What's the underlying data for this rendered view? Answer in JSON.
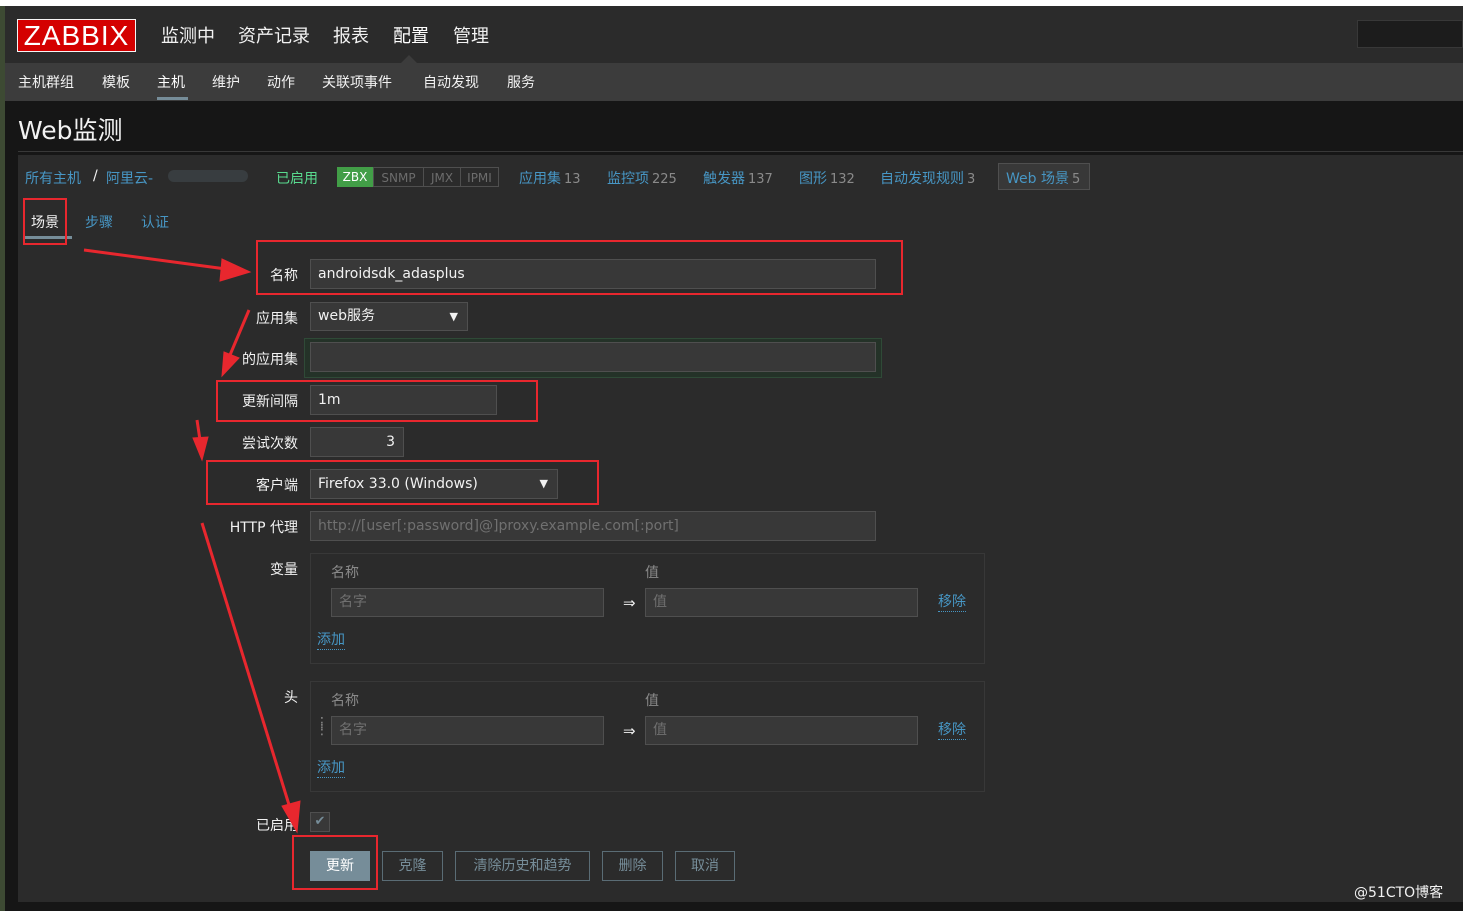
{
  "app": {
    "logo": "ZABBIX"
  },
  "main_menu": [
    "监测中",
    "资产记录",
    "报表",
    "配置",
    "管理"
  ],
  "main_menu_active": "配置",
  "sub_menu": [
    "主机群组",
    "模板",
    "主机",
    "维护",
    "动作",
    "关联项事件",
    "自动发现",
    "服务"
  ],
  "sub_menu_active": "主机",
  "page_title": "Web监测",
  "host_nav": {
    "all_hosts": "所有主机",
    "separator": "/",
    "host_name": "阿里云-",
    "status": "已启用",
    "availability": [
      "ZBX",
      "SNMP",
      "JMX",
      "IPMI"
    ],
    "links": [
      {
        "label": "应用集",
        "count": "13"
      },
      {
        "label": "监控项",
        "count": "225"
      },
      {
        "label": "触发器",
        "count": "137"
      },
      {
        "label": "图形",
        "count": "132"
      },
      {
        "label": "自动发现规则",
        "count": "3"
      },
      {
        "label": "Web 场景",
        "count": "5"
      }
    ]
  },
  "tabs": [
    "场景",
    "步骤",
    "认证"
  ],
  "form": {
    "name_label": "名称",
    "name_value": "androidsdk_adasplus",
    "application_label": "应用集",
    "application_value": "web服务",
    "new_application_label": "的应用集",
    "update_interval_label": "更新间隔",
    "update_interval_value": "1m",
    "attempts_label": "尝试次数",
    "attempts_value": "3",
    "agent_label": "客户端",
    "agent_value": "Firefox 33.0 (Windows)",
    "http_proxy_label": "HTTP 代理",
    "http_proxy_placeholder": "http://[user[:password]@]proxy.example.com[:port]",
    "variables_label": "变量",
    "headers_label": "头",
    "col_name": "名称",
    "col_value": "值",
    "name_placeholder": "名字",
    "value_placeholder": "值",
    "arrow": "⇒",
    "remove": "移除",
    "add": "添加",
    "enabled_label": "已启用",
    "enabled_checked": true,
    "checkmark": "✔"
  },
  "buttons": [
    "更新",
    "克隆",
    "清除历史和趋势",
    "删除",
    "取消"
  ],
  "watermark": "@51CTO博客",
  "colors": {
    "logo_bg": "#d40000",
    "link": "#4796c4",
    "enabled_green": "#59db8f",
    "zbx_green": "#429e47",
    "annotation_red": "#e8272e",
    "primary_button": "#768d99"
  }
}
